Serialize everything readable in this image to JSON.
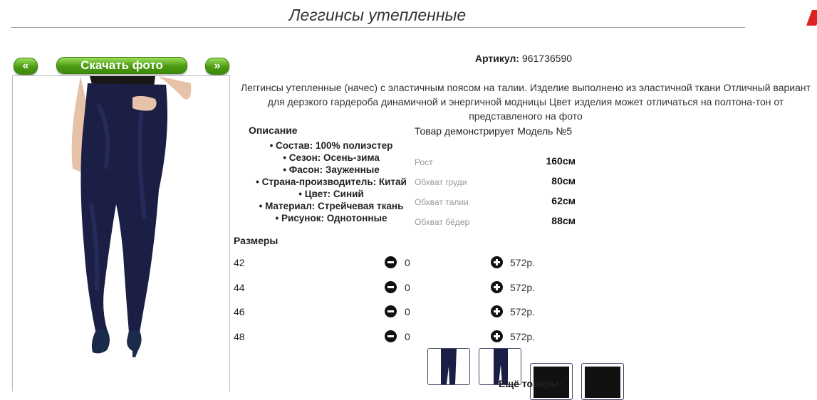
{
  "page": {
    "title": "Леггинсы утепленные"
  },
  "gallery": {
    "prev_label": "«",
    "next_label": "»",
    "download_label": "Скачать фото"
  },
  "product": {
    "article_label": "Артикул:",
    "article_value": "961736590",
    "description": "Леггинсы утепленные (начес) с эластичным поясом на талии. Изделие выполнено из эластичной ткани Отличный вариант для дерзкого гардероба динамичной и энергичной модницы Цвет изделия может отличаться на полтона-тон от представленого на фото"
  },
  "details": {
    "heading": "Описание",
    "items": [
      "Состав: 100% полиэстер",
      "Сезон: Осень-зима",
      "Фасон: Зауженные",
      "Страна-производитель: Китай",
      "Цвет: Синий",
      "Материал: Стрейчевая ткань",
      "Рисунок: Однотонные"
    ]
  },
  "model": {
    "heading": "Товар демонстрирует Модель №5",
    "measures": [
      {
        "label": "Рост",
        "value": "160см"
      },
      {
        "label": "Обхват груди",
        "value": "80см"
      },
      {
        "label": "Обхват талии",
        "value": "62см"
      },
      {
        "label": "Обхват бёдер",
        "value": "88см"
      }
    ]
  },
  "sizes": {
    "heading": "Размеры",
    "rows": [
      {
        "size": "42",
        "qty": "0",
        "price": "572р."
      },
      {
        "size": "44",
        "qty": "0",
        "price": "572р."
      },
      {
        "size": "46",
        "qty": "0",
        "price": "572р."
      },
      {
        "size": "48",
        "qty": "0",
        "price": "572р."
      }
    ]
  },
  "more": {
    "label": "Ещё товары:"
  },
  "colors": {
    "accent_green": "#4c9a12",
    "product_navy": "#1c1f45"
  }
}
